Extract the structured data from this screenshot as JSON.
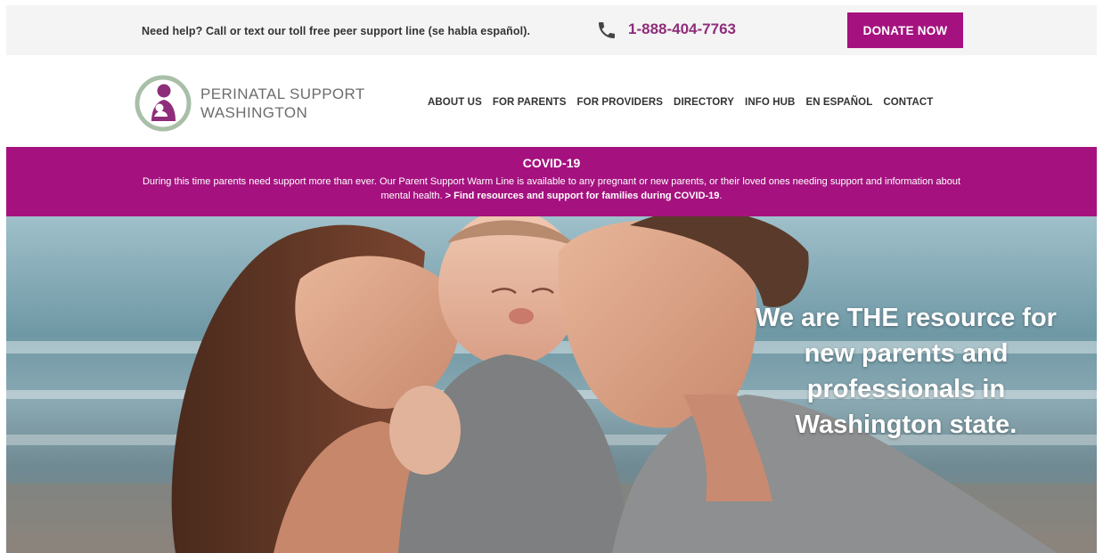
{
  "topbar": {
    "help_text": "Need help? Call or text our toll free peer support line (se habla español).",
    "phone_icon": "phone-icon",
    "phone_number": "1-888-404-7763",
    "donate_label": "DONATE NOW"
  },
  "header": {
    "logo_icon": "mother-child-logo",
    "logo_line1": "PERINATAL SUPPORT",
    "logo_line2": "WASHINGTON",
    "nav": [
      {
        "label": "ABOUT US"
      },
      {
        "label": "FOR PARENTS"
      },
      {
        "label": "FOR PROVIDERS"
      },
      {
        "label": "DIRECTORY"
      },
      {
        "label": "INFO HUB"
      },
      {
        "label": "EN ESPAÑOL"
      },
      {
        "label": "CONTACT"
      }
    ]
  },
  "covid": {
    "title": "COVID-19",
    "body": "During this time parents need support more than ever. Our Parent Support Warm Line is available to any pregnant or new parents, or their loved ones needing support and information about mental health.",
    "link": "> Find resources and support for families during COVID-19",
    "trailing": "."
  },
  "hero": {
    "headline": "We are THE resource for new parents and professionals in Washington state."
  },
  "colors": {
    "brand_magenta": "#a5127f",
    "phone_purple": "#8e2d7a",
    "logo_sage": "#a9bfa8"
  }
}
